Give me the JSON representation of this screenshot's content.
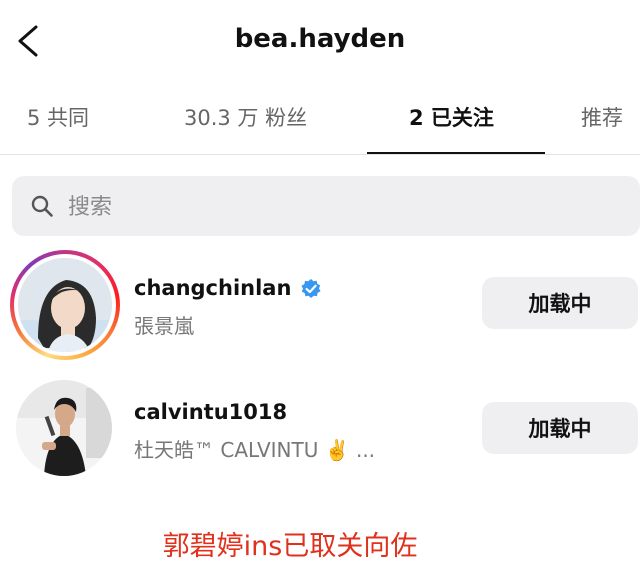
{
  "header": {
    "title": "bea.hayden"
  },
  "tabs": [
    {
      "label": "5 共同"
    },
    {
      "label": "30.3 万 粉丝"
    },
    {
      "label": "2 已关注"
    },
    {
      "label": "推荐"
    }
  ],
  "search": {
    "placeholder": "搜索"
  },
  "rows": [
    {
      "username": "changchinlan",
      "full_name": "張景嵐",
      "verified": true,
      "button_label": "加载中"
    },
    {
      "username": "calvintu1018",
      "full_name": "杜天皓™ CALVINTU ✌️ ...",
      "verified": false,
      "button_label": "加载中"
    }
  ],
  "caption": "郭碧婷ins已取关向佐",
  "colors": {
    "verified": "#3897f0",
    "caption": "#e0311c"
  }
}
